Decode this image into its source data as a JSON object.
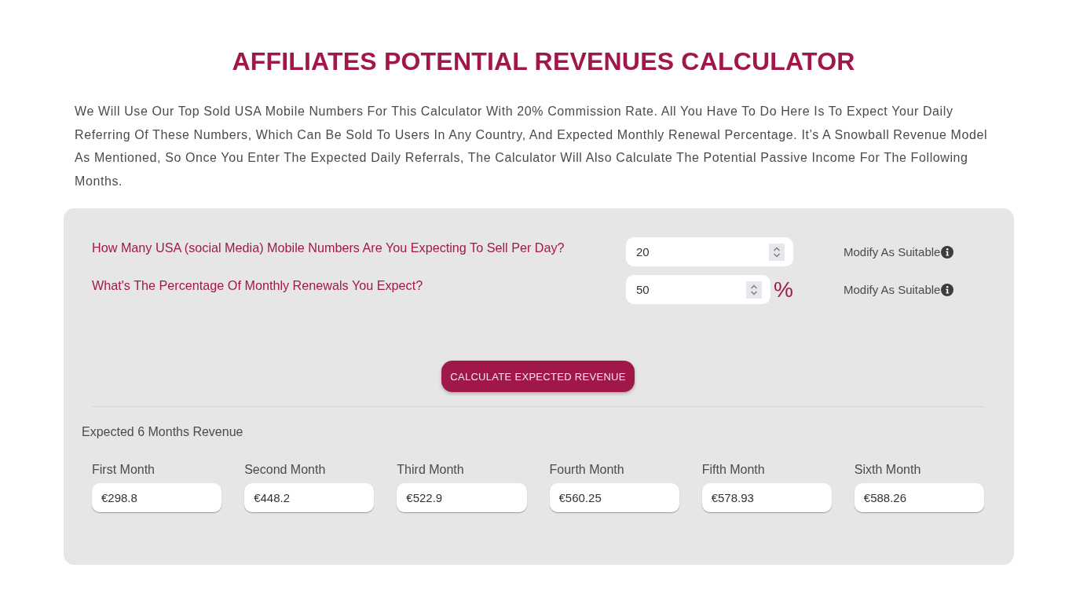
{
  "title": "AFFILIATES POTENTIAL REVENUES CALCULATOR",
  "intro": "We Will Use Our Top Sold USA Mobile Numbers For This Calculator With 20% Commission Rate. All You Have To Do Here Is To Expect Your Daily Referring Of These Numbers, Which Can Be Sold To Users In Any Country, And Expected Monthly Renewal Percentage. It’s A Snowball Revenue Model As Mentioned, So Once You Enter The Expected Daily Referrals, The Calculator Will Also Calculate The Potential Passive Income For The Following Months.",
  "calculator": {
    "questions": [
      {
        "label": "How Many USA (social Media) Mobile Numbers Are You Expecting To Sell Per Day?",
        "value": "20",
        "note": "Modify As Suitable"
      },
      {
        "label": "What's The Percentage Of Monthly Renewals You Expect?",
        "value": "50",
        "unit": "%",
        "note": "Modify As Suitable"
      }
    ],
    "button": "CALCULATE EXPECTED REVENUE",
    "results": {
      "heading": "Expected 6 Months Revenue",
      "months": [
        {
          "label": "First Month",
          "value": "€298.8"
        },
        {
          "label": "Second Month",
          "value": "€448.2"
        },
        {
          "label": "Third Month",
          "value": "€522.9"
        },
        {
          "label": "Fourth Month",
          "value": "€560.25"
        },
        {
          "label": "Fifth Month",
          "value": "€578.93"
        },
        {
          "label": "Sixth Month",
          "value": "€588.26"
        }
      ]
    }
  }
}
